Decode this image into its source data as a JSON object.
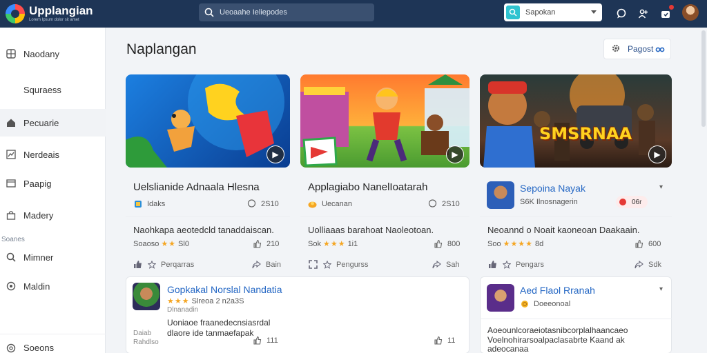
{
  "app": {
    "title": "Upplangian",
    "subtitle": "Lorem Ipsum dolor sit amet"
  },
  "search": {
    "text": "Ueoaahe Ieliepodes"
  },
  "region_select": {
    "value": "Sapokan"
  },
  "sidebar": {
    "items": [
      {
        "label": "Naodany",
        "icon": "grid-icon"
      },
      {
        "label": "Squraess",
        "icon": ""
      },
      {
        "label": "Pecuarie",
        "icon": "home-icon"
      },
      {
        "label": "Nerdeais",
        "icon": "chart-icon"
      },
      {
        "label": "Paapig",
        "icon": "folder-icon"
      },
      {
        "label": "Madery",
        "icon": "bag-icon"
      },
      {
        "label": "Mimner",
        "icon": "search-icon"
      },
      {
        "label": "Maldin",
        "icon": "circle-icon"
      },
      {
        "label": "Soeons",
        "icon": "settings-icon"
      }
    ],
    "section_label": "Soanes"
  },
  "main": {
    "title": "Naplangan",
    "page_button": "Pagost"
  },
  "cards": [
    {
      "title": "Uelslianide Adnaala Hlesna",
      "tag": "Idaks",
      "comments": "2S10",
      "desc": "Naohkapa aeotedcld tanaddaiscan.",
      "rating_prefix": "Soaoso",
      "stars": "★★",
      "rating_count": "Sl0",
      "rating_num": "210",
      "action_left": "Perqarras",
      "action_right": "Bain"
    },
    {
      "title": "Applagiabo NanelIoatarah",
      "tag": "Uecanan",
      "comments": "2S10",
      "desc": "Uolliaaas barahoat Naoleotoan.",
      "rating_prefix": "Sok",
      "stars": "★★★",
      "rating_count": "1i1",
      "rating_num": "800",
      "action_left": "Pengurss",
      "action_right": "Sah"
    },
    {
      "title": "Sepoina Nayak",
      "subtitle": "S6K Ilnosnagerin",
      "pill": "06r",
      "desc": "Neoannd o Noait kaoneoan Daakaain.",
      "rating_prefix": "Soo",
      "stars": "★★★★",
      "rating_count": "8d",
      "rating_num": "600",
      "action_left": "Pengars",
      "action_right": "Sdk",
      "banner_text": "SMSRNAA"
    },
    {
      "title": "Gopkakal Norslal Nandatia",
      "stars": "★★★",
      "stars_text": "Slreoa 2 n2a3S",
      "sub": "Dlnanadin",
      "desc1": "Uoniaoe fraanedecnsiasrdal",
      "desc2": "dlaore ide tanmaefapak",
      "foot1": "Daiab",
      "foot2": "Rahdlso",
      "num_a": "111",
      "num_b": "11"
    },
    {
      "title": "Aed Flaol Rranah",
      "sub": "Doeeonoal",
      "desc1": "Aoeounlcoraeiotasnibcorplalhaancaeo",
      "desc2": "Voelnohirarsoalpaclasabrte Kaand ak",
      "desc3": "adeocanaa"
    }
  ],
  "colors": {
    "topbar": "#1e3556",
    "accent": "#2467c4",
    "star": "#f5a623"
  }
}
